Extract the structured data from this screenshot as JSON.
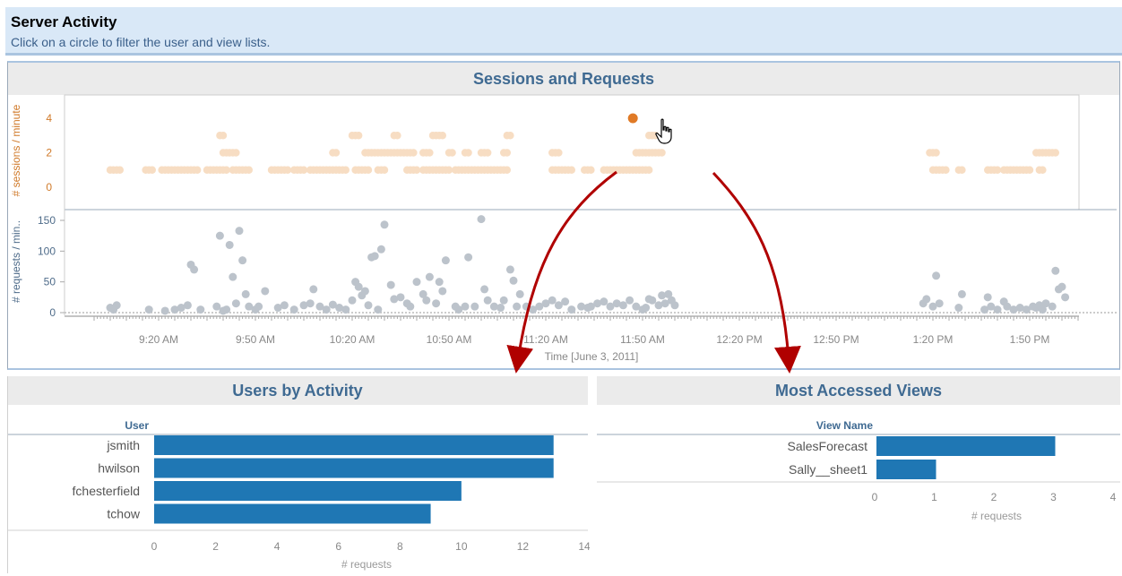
{
  "header": {
    "title": "Server Activity",
    "subtitle": "Click on a circle to filter the user and view lists."
  },
  "sessions_panel": {
    "title": "Sessions and Requests",
    "sessions_axis_label": "# sessions / minute",
    "requests_axis_label": "# requests / min..",
    "x_axis_title": "Time [June 3, 2011]"
  },
  "users_panel": {
    "title": "Users by Activity",
    "header": "User",
    "axis_title": "# requests"
  },
  "views_panel": {
    "title": "Most Accessed Views",
    "header": "View Name",
    "axis_title": "# requests"
  },
  "colors": {
    "bar": "#1f77b4",
    "session_dot": "#f7ddc3",
    "request_dot": "#bcc3cb",
    "selected_dot": "#e07a26",
    "arrow": "#b00000"
  },
  "chart_data": [
    {
      "type": "scatter",
      "name": "sessions",
      "ylabel": "# sessions / minute",
      "ylim": [
        0,
        4
      ],
      "yticks": [
        0,
        2,
        4
      ],
      "xticks": [
        "9:20 AM",
        "9:50 AM",
        "10:20 AM",
        "10:50 AM",
        "11:20 AM",
        "11:50 AM",
        "12:20 PM",
        "12:50 PM",
        "1:20 PM",
        "1:50 PM"
      ],
      "selected": {
        "x": "11:47 AM",
        "y": 4
      },
      "groups": [
        {
          "y": 1,
          "ranges": [
            [
              "9:05 AM",
              "9:08 AM"
            ],
            [
              "9:16 AM",
              "9:18 AM"
            ],
            [
              "9:21 AM",
              "9:32 AM"
            ],
            [
              "9:35 AM",
              "9:41 AM"
            ],
            [
              "9:43 AM",
              "9:48 AM"
            ],
            [
              "9:55 AM",
              "10:00 AM"
            ],
            [
              "10:02 AM",
              "10:05 AM"
            ],
            [
              "10:07 AM",
              "10:18 AM"
            ],
            [
              "10:21 AM",
              "10:25 AM"
            ],
            [
              "10:28 AM",
              "10:30 AM"
            ],
            [
              "10:37 AM",
              "10:40 AM"
            ],
            [
              "10:42 AM",
              "10:50 AM"
            ],
            [
              "10:52 AM",
              "11:08 AM"
            ],
            [
              "11:22 AM",
              "11:28 AM"
            ],
            [
              "11:32 AM",
              "11:34 AM"
            ],
            [
              "11:38 AM",
              "11:52 AM"
            ],
            [
              "1:20 PM",
              "1:24 PM"
            ],
            [
              "1:28 PM",
              "1:29 PM"
            ],
            [
              "1:37 PM",
              "1:40 PM"
            ],
            [
              "1:42 PM",
              "1:50 PM"
            ],
            [
              "1:53 PM",
              "1:54 PM"
            ]
          ]
        },
        {
          "y": 2,
          "ranges": [
            [
              "9:40 AM",
              "9:44 AM"
            ],
            [
              "10:14 AM",
              "10:15 AM"
            ],
            [
              "10:24 AM",
              "10:39 AM"
            ],
            [
              "10:42 AM",
              "10:44 AM"
            ],
            [
              "10:50 AM",
              "10:51 AM"
            ],
            [
              "10:55 AM",
              "10:56 AM"
            ],
            [
              "11:00 AM",
              "11:02 AM"
            ],
            [
              "11:07 AM",
              "11:08 AM"
            ],
            [
              "11:22 AM",
              "11:24 AM"
            ],
            [
              "11:48 AM",
              "11:56 AM"
            ],
            [
              "1:19 PM",
              "1:21 PM"
            ],
            [
              "1:52 PM",
              "1:58 PM"
            ]
          ]
        },
        {
          "y": 3,
          "ranges": [
            [
              "9:39 AM",
              "9:40 AM"
            ],
            [
              "10:20 AM",
              "10:22 AM"
            ],
            [
              "10:33 AM",
              "10:34 AM"
            ],
            [
              "10:45 AM",
              "10:48 AM"
            ],
            [
              "11:08 AM",
              "11:09 AM"
            ],
            [
              "11:52 AM",
              "11:54 AM"
            ]
          ]
        }
      ]
    },
    {
      "type": "scatter",
      "name": "requests",
      "ylabel": "# requests / min..",
      "ylim": [
        0,
        150
      ],
      "yticks": [
        0,
        50,
        100,
        150
      ],
      "xlabel": "Time [June 3, 2011]",
      "points": [
        [
          "9:05 AM",
          8
        ],
        [
          "9:06 AM",
          5
        ],
        [
          "9:07 AM",
          12
        ],
        [
          "9:17 AM",
          5
        ],
        [
          "9:22 AM",
          3
        ],
        [
          "9:25 AM",
          5
        ],
        [
          "9:27 AM",
          8
        ],
        [
          "9:29 AM",
          12
        ],
        [
          "9:30 AM",
          78
        ],
        [
          "9:31 AM",
          70
        ],
        [
          "9:33 AM",
          5
        ],
        [
          "9:38 AM",
          10
        ],
        [
          "9:39 AM",
          125
        ],
        [
          "9:40 AM",
          3
        ],
        [
          "9:41 AM",
          5
        ],
        [
          "9:42 AM",
          110
        ],
        [
          "9:43 AM",
          58
        ],
        [
          "9:44 AM",
          15
        ],
        [
          "9:45 AM",
          133
        ],
        [
          "9:46 AM",
          85
        ],
        [
          "9:47 AM",
          30
        ],
        [
          "9:48 AM",
          10
        ],
        [
          "9:50 AM",
          5
        ],
        [
          "9:51 AM",
          10
        ],
        [
          "9:53 AM",
          35
        ],
        [
          "9:57 AM",
          8
        ],
        [
          "9:59 AM",
          12
        ],
        [
          "10:02 AM",
          5
        ],
        [
          "10:05 AM",
          12
        ],
        [
          "10:07 AM",
          15
        ],
        [
          "10:08 AM",
          38
        ],
        [
          "10:10 AM",
          10
        ],
        [
          "10:12 AM",
          5
        ],
        [
          "10:14 AM",
          13
        ],
        [
          "10:16 AM",
          8
        ],
        [
          "10:18 AM",
          5
        ],
        [
          "10:20 AM",
          20
        ],
        [
          "10:21 AM",
          50
        ],
        [
          "10:22 AM",
          42
        ],
        [
          "10:23 AM",
          28
        ],
        [
          "10:24 AM",
          35
        ],
        [
          "10:25 AM",
          12
        ],
        [
          "10:26 AM",
          90
        ],
        [
          "10:27 AM",
          92
        ],
        [
          "10:28 AM",
          5
        ],
        [
          "10:29 AM",
          103
        ],
        [
          "10:30 AM",
          143
        ],
        [
          "10:32 AM",
          45
        ],
        [
          "10:33 AM",
          22
        ],
        [
          "10:35 AM",
          25
        ],
        [
          "10:37 AM",
          15
        ],
        [
          "10:38 AM",
          10
        ],
        [
          "10:40 AM",
          50
        ],
        [
          "10:42 AM",
          30
        ],
        [
          "10:43 AM",
          20
        ],
        [
          "10:44 AM",
          58
        ],
        [
          "10:46 AM",
          15
        ],
        [
          "10:47 AM",
          50
        ],
        [
          "10:48 AM",
          35
        ],
        [
          "10:49 AM",
          85
        ],
        [
          "10:52 AM",
          10
        ],
        [
          "10:53 AM",
          5
        ],
        [
          "10:55 AM",
          10
        ],
        [
          "10:56 AM",
          90
        ],
        [
          "10:58 AM",
          10
        ],
        [
          "11:00 AM",
          152
        ],
        [
          "11:01 AM",
          38
        ],
        [
          "11:02 AM",
          20
        ],
        [
          "11:04 AM",
          10
        ],
        [
          "11:06 AM",
          8
        ],
        [
          "11:07 AM",
          20
        ],
        [
          "11:09 AM",
          70
        ],
        [
          "11:10 AM",
          52
        ],
        [
          "11:11 AM",
          10
        ],
        [
          "11:12 AM",
          30
        ],
        [
          "11:14 AM",
          10
        ],
        [
          "11:16 AM",
          5
        ],
        [
          "11:18 AM",
          10
        ],
        [
          "11:20 AM",
          15
        ],
        [
          "11:22 AM",
          20
        ],
        [
          "11:24 AM",
          12
        ],
        [
          "11:26 AM",
          18
        ],
        [
          "11:28 AM",
          5
        ],
        [
          "11:31 AM",
          10
        ],
        [
          "11:33 AM",
          8
        ],
        [
          "11:34 AM",
          10
        ],
        [
          "11:36 AM",
          15
        ],
        [
          "11:38 AM",
          18
        ],
        [
          "11:40 AM",
          10
        ],
        [
          "11:42 AM",
          15
        ],
        [
          "11:44 AM",
          12
        ],
        [
          "11:46 AM",
          20
        ],
        [
          "11:48 AM",
          10
        ],
        [
          "11:50 AM",
          5
        ],
        [
          "11:51 AM",
          8
        ],
        [
          "11:52 AM",
          22
        ],
        [
          "11:53 AM",
          20
        ],
        [
          "11:55 AM",
          12
        ],
        [
          "11:56 AM",
          28
        ],
        [
          "11:57 AM",
          15
        ],
        [
          "11:58 AM",
          30
        ],
        [
          "11:59 AM",
          20
        ],
        [
          "12:00 PM",
          12
        ],
        [
          "1:17 PM",
          15
        ],
        [
          "1:18 PM",
          22
        ],
        [
          "1:20 PM",
          10
        ],
        [
          "1:21 PM",
          60
        ],
        [
          "1:22 PM",
          15
        ],
        [
          "1:28 PM",
          8
        ],
        [
          "1:29 PM",
          30
        ],
        [
          "1:36 PM",
          5
        ],
        [
          "1:37 PM",
          25
        ],
        [
          "1:38 PM",
          10
        ],
        [
          "1:40 PM",
          5
        ],
        [
          "1:42 PM",
          18
        ],
        [
          "1:43 PM",
          10
        ],
        [
          "1:45 PM",
          5
        ],
        [
          "1:47 PM",
          8
        ],
        [
          "1:49 PM",
          5
        ],
        [
          "1:51 PM",
          10
        ],
        [
          "1:52 PM",
          8
        ],
        [
          "1:53 PM",
          12
        ],
        [
          "1:54 PM",
          5
        ],
        [
          "1:55 PM",
          15
        ],
        [
          "1:57 PM",
          10
        ],
        [
          "1:58 PM",
          68
        ],
        [
          "1:59 PM",
          38
        ],
        [
          "2:00 PM",
          42
        ],
        [
          "2:01 PM",
          25
        ]
      ]
    },
    {
      "type": "bar",
      "name": "Users by Activity",
      "categories": [
        "jsmith",
        "hwilson",
        "fchesterfield",
        "tchow"
      ],
      "values": [
        13,
        13,
        10,
        9
      ],
      "xlim": [
        0,
        14
      ],
      "xticks": [
        0,
        2,
        4,
        6,
        8,
        10,
        12,
        14
      ],
      "xlabel": "# requests"
    },
    {
      "type": "bar",
      "name": "Most Accessed Views",
      "categories": [
        "SalesForecast",
        "Sally__sheet1"
      ],
      "values": [
        3,
        1
      ],
      "xlim": [
        0,
        4
      ],
      "xticks": [
        0,
        1,
        2,
        3,
        4
      ],
      "xlabel": "# requests"
    }
  ]
}
